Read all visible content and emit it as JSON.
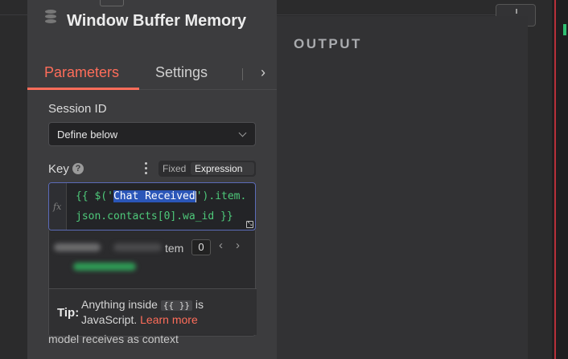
{
  "node": {
    "title": "Window Buffer Memory"
  },
  "tabs": {
    "parameters": "Parameters",
    "settings": "Settings"
  },
  "session": {
    "label": "Session ID",
    "select_value": "Define below"
  },
  "key": {
    "label": "Key",
    "mode_fixed": "Fixed",
    "mode_expression": "Expression",
    "expression_line1_pre": "{{ $('",
    "expression_selected": "Chat Received",
    "expression_line1_post": "').item.",
    "expression_line2": "json.contacts[0].wa_id }}",
    "fx_label": "fx"
  },
  "result": {
    "item_label_partial": "tem",
    "item_index": "0"
  },
  "tip": {
    "label": "Tip:",
    "text_before": "Anything inside",
    "code": "{{ }}",
    "text_after": "is",
    "text_line2": "JavaScript.",
    "link": "Learn more"
  },
  "footnote": "model receives as context",
  "output": {
    "title": "OUTPUT"
  },
  "colors": {
    "accent": "#ff6d5a",
    "code_green": "#4ec97a",
    "selection": "#2b56b8"
  },
  "icons": [
    "database-icon",
    "help-icon",
    "kebab-menu-icon",
    "chevron-down-icon",
    "chevron-right-icon",
    "chevron-left-icon",
    "expand-icon"
  ]
}
